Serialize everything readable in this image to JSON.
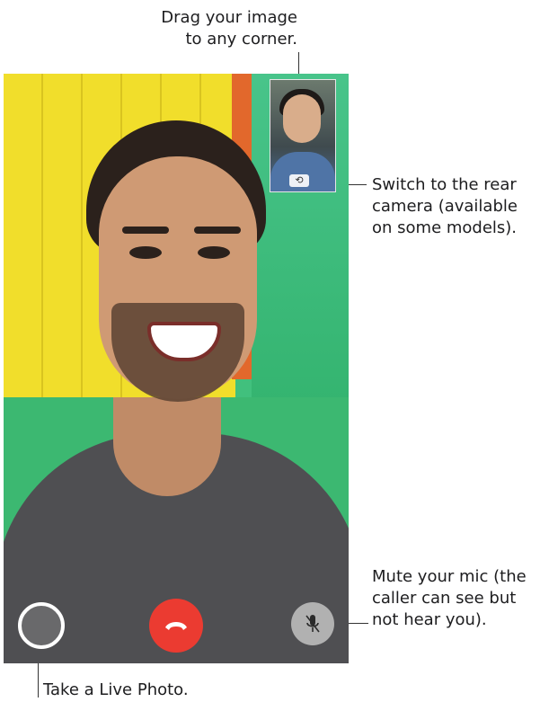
{
  "callouts": {
    "drag": [
      "Drag your image",
      "to any corner."
    ],
    "switch": [
      "Switch to the rear",
      "camera (available",
      "on some models)."
    ],
    "mute": [
      "Mute your mic (the",
      "caller can see but",
      "not hear you)."
    ],
    "live": "Take a Live Photo."
  },
  "icons": {
    "end_call": "phone-hangup-icon",
    "mute": "microphone-slash-icon",
    "switch_camera": "camera-rotate-icon",
    "live_photo": "shutter-icon"
  },
  "colors": {
    "end_call": "#eb3b31",
    "mute_bg": "#d2d2d2"
  }
}
